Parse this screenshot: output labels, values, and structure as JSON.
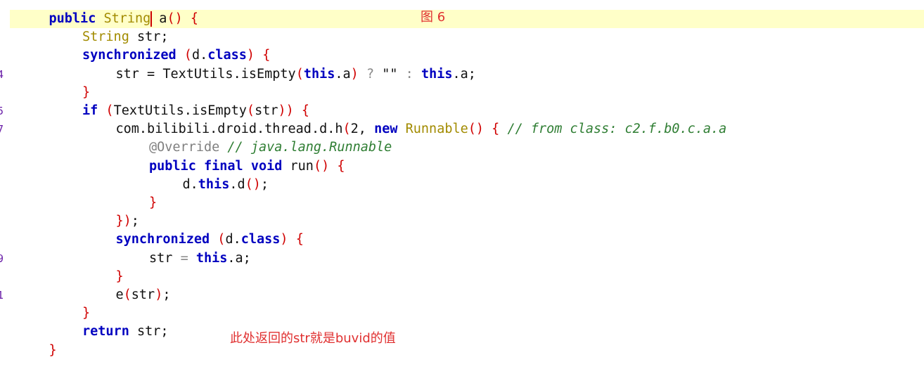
{
  "editor": {
    "gutter": [
      "",
      "",
      "",
      "4",
      "",
      "5",
      "7",
      "",
      "",
      "",
      "",
      "",
      "",
      "9",
      "",
      "1",
      "",
      "",
      ""
    ],
    "lines": [
      {
        "indent": 1,
        "tokens": [
          [
            "kw",
            "public"
          ],
          [
            "pl",
            " "
          ],
          [
            "ty",
            "String"
          ],
          [
            "caret",
            ""
          ],
          [
            "pl",
            "a"
          ],
          [
            "br",
            "()"
          ],
          [
            "pl",
            " "
          ],
          [
            "br",
            "{"
          ]
        ]
      },
      {
        "indent": 2,
        "tokens": [
          [
            "ty",
            "String"
          ],
          [
            "pl",
            " str;"
          ]
        ]
      },
      {
        "indent": 2,
        "tokens": [
          [
            "kw",
            "synchronized"
          ],
          [
            "pl",
            " "
          ],
          [
            "br",
            "("
          ],
          [
            "pl",
            "d."
          ],
          [
            "kw",
            "class"
          ],
          [
            "br",
            ")"
          ],
          [
            "pl",
            " "
          ],
          [
            "br",
            "{"
          ]
        ]
      },
      {
        "indent": 3,
        "tokens": [
          [
            "pl",
            "str = TextUtils.isEmpty"
          ],
          [
            "br",
            "("
          ],
          [
            "kw",
            "this"
          ],
          [
            "pl",
            ".a"
          ],
          [
            "br",
            ")"
          ],
          [
            "pl",
            " "
          ],
          [
            "op",
            "?"
          ],
          [
            "pl",
            " "
          ],
          [
            "st",
            "\"\""
          ],
          [
            "pl",
            " "
          ],
          [
            "op",
            ":"
          ],
          [
            "pl",
            " "
          ],
          [
            "kw",
            "this"
          ],
          [
            "pl",
            ".a;"
          ]
        ]
      },
      {
        "indent": 2,
        "tokens": [
          [
            "br",
            "}"
          ]
        ]
      },
      {
        "indent": 2,
        "tokens": [
          [
            "kw",
            "if"
          ],
          [
            "pl",
            " "
          ],
          [
            "br",
            "("
          ],
          [
            "pl",
            "TextUtils.isEmpty"
          ],
          [
            "br",
            "("
          ],
          [
            "pl",
            "str"
          ],
          [
            "br",
            "))"
          ],
          [
            "pl",
            " "
          ],
          [
            "br",
            "{"
          ]
        ]
      },
      {
        "indent": 3,
        "tokens": [
          [
            "pl",
            "com.bilibili.droid.thread.d.h"
          ],
          [
            "br",
            "("
          ],
          [
            "pl",
            "2, "
          ],
          [
            "kw",
            "new"
          ],
          [
            "pl",
            " "
          ],
          [
            "ty",
            "Runnable"
          ],
          [
            "br",
            "()"
          ],
          [
            "pl",
            " "
          ],
          [
            "br",
            "{"
          ],
          [
            "pl",
            " "
          ],
          [
            "cm",
            "// from class: c2.f.b0.c.a.a"
          ]
        ]
      },
      {
        "indent": 4,
        "tokens": [
          [
            "an",
            "@Override"
          ],
          [
            "pl",
            " "
          ],
          [
            "cm",
            "// java.lang.Runnable"
          ]
        ]
      },
      {
        "indent": 4,
        "tokens": [
          [
            "kw",
            "public"
          ],
          [
            "pl",
            " "
          ],
          [
            "kw",
            "final"
          ],
          [
            "pl",
            " "
          ],
          [
            "kw",
            "void"
          ],
          [
            "pl",
            " run"
          ],
          [
            "br",
            "()"
          ],
          [
            "pl",
            " "
          ],
          [
            "br",
            "{"
          ]
        ]
      },
      {
        "indent": 5,
        "tokens": [
          [
            "pl",
            "d."
          ],
          [
            "kw",
            "this"
          ],
          [
            "pl",
            ".d"
          ],
          [
            "br",
            "()"
          ],
          [
            "pl",
            ";"
          ]
        ]
      },
      {
        "indent": 4,
        "tokens": [
          [
            "br",
            "}"
          ]
        ]
      },
      {
        "indent": 3,
        "tokens": [
          [
            "br",
            "})"
          ],
          [
            "pl",
            ";"
          ]
        ]
      },
      {
        "indent": 3,
        "tokens": [
          [
            "kw",
            "synchronized"
          ],
          [
            "pl",
            " "
          ],
          [
            "br",
            "("
          ],
          [
            "pl",
            "d."
          ],
          [
            "kw",
            "class"
          ],
          [
            "br",
            ")"
          ],
          [
            "pl",
            " "
          ],
          [
            "br",
            "{"
          ]
        ]
      },
      {
        "indent": 4,
        "tokens": [
          [
            "pl",
            "str "
          ],
          [
            "op",
            "="
          ],
          [
            "pl",
            " "
          ],
          [
            "kw",
            "this"
          ],
          [
            "pl",
            ".a;"
          ]
        ]
      },
      {
        "indent": 3,
        "tokens": [
          [
            "br",
            "}"
          ]
        ]
      },
      {
        "indent": 3,
        "tokens": [
          [
            "pl",
            "e"
          ],
          [
            "br",
            "("
          ],
          [
            "pl",
            "str"
          ],
          [
            "br",
            ")"
          ],
          [
            "pl",
            ";"
          ]
        ]
      },
      {
        "indent": 2,
        "tokens": [
          [
            "br",
            "}"
          ]
        ]
      },
      {
        "indent": 2,
        "tokens": [
          [
            "kw",
            "return"
          ],
          [
            "pl",
            " str;"
          ]
        ]
      },
      {
        "indent": 1,
        "tokens": [
          [
            "br",
            "}"
          ]
        ]
      }
    ]
  },
  "annotations": {
    "figure_label": "图 6",
    "return_note": "此处返回的str就是buvid的值"
  },
  "colors": {
    "keyword": "#0000c0",
    "type": "#a28b00",
    "bracket": "#d00000",
    "comment": "#2e7d32",
    "annotation": "#808080",
    "current_line": "#ffffc8",
    "note": "#e03030"
  }
}
